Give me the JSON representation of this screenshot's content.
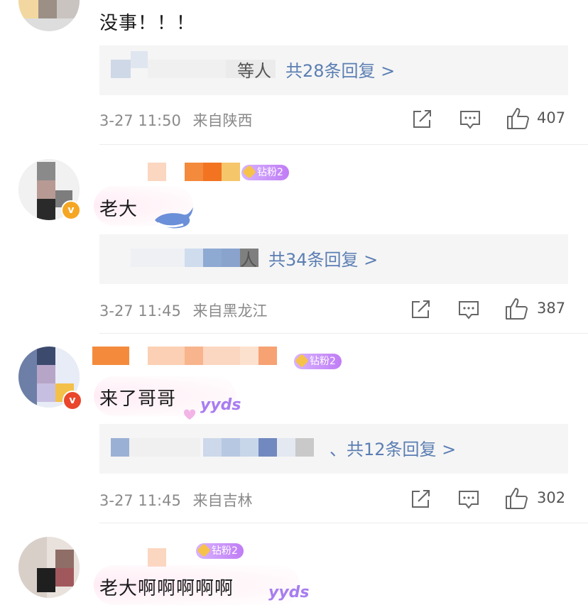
{
  "comments": [
    {
      "text": "没事！！！",
      "reply_ren": "等人",
      "reply_link": "共28条回复 >",
      "time": "3-27 11:50",
      "location": "来自陕西",
      "likes": "407"
    },
    {
      "fan_badge": "钻粉2",
      "text": "老大",
      "reply_ren": "人",
      "reply_link": "共34条回复 >",
      "time": "3-27 11:45",
      "location": "来自黑龙江",
      "likes": "387"
    },
    {
      "fan_badge": "钻粉2",
      "text": "来了哥哥",
      "decoration": "yyds",
      "reply_link": "、共12条回复 >",
      "time": "3-27 11:45",
      "location": "来自吉林",
      "likes": "302"
    },
    {
      "fan_badge": "钻粉2",
      "text": "老大啊啊啊啊啊",
      "decoration": "yyds"
    }
  ],
  "icons": {
    "share": "share-icon",
    "comment": "comment-icon",
    "like": "thumbs-up-icon"
  },
  "colors": {
    "link": "#5b7eb3",
    "meta": "#8a8a8a",
    "fan_badge": "#c07cf5",
    "verified": "#f5a623"
  }
}
